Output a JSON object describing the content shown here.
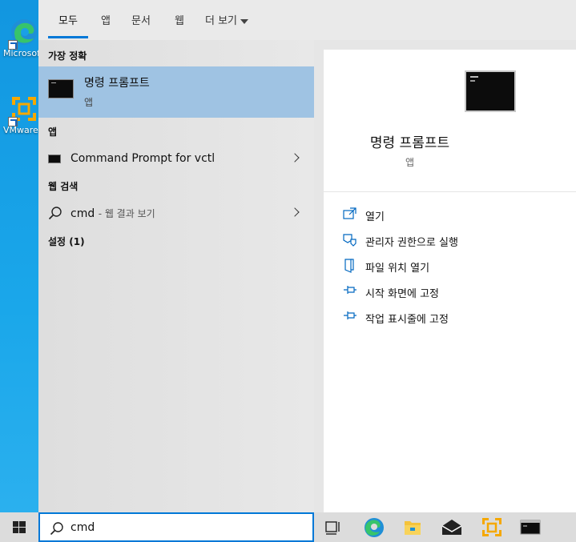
{
  "desktop": {
    "icons": [
      {
        "label": "Microsoft Edge",
        "icon": "edge-icon"
      },
      {
        "label": "VMware Workstation",
        "icon": "vmware-icon"
      }
    ]
  },
  "tabs": [
    {
      "label": "모두",
      "active": true
    },
    {
      "label": "앱"
    },
    {
      "label": "문서"
    },
    {
      "label": "웹"
    },
    {
      "label": "더 보기"
    }
  ],
  "left": {
    "best_match_title": "가장 정확",
    "best_match": {
      "name": "명령 프롬프트",
      "type": "앱",
      "icon": "command-prompt-icon"
    },
    "apps_title": "앱",
    "apps": [
      {
        "name": "Command Prompt for vctl",
        "icon": "command-prompt-icon"
      }
    ],
    "web_title": "웹 검색",
    "web": {
      "query": "cmd",
      "suffix": "- 웹 결과 보기"
    },
    "settings_title": "설정 (1)"
  },
  "right": {
    "name": "명령 프롬프트",
    "type": "앱",
    "actions": [
      {
        "label": "열기",
        "icon": "open-icon"
      },
      {
        "label": "관리자 권한으로 실행",
        "icon": "shield-icon"
      },
      {
        "label": "파일 위치 열기",
        "icon": "file-location-icon"
      },
      {
        "label": "시작 화면에 고정",
        "icon": "pin-icon"
      },
      {
        "label": "작업 표시줄에 고정",
        "icon": "pin-icon"
      }
    ]
  },
  "taskbar": {
    "search_value": "cmd",
    "icons": [
      "windows-icon",
      "task-view-icon",
      "edge-icon",
      "file-explorer-icon",
      "mail-icon",
      "vmware-icon",
      "command-prompt-icon"
    ]
  },
  "colors": {
    "accent": "#0078d7",
    "selection": "#9fc3e3",
    "desktop": "#1aa0e6"
  }
}
